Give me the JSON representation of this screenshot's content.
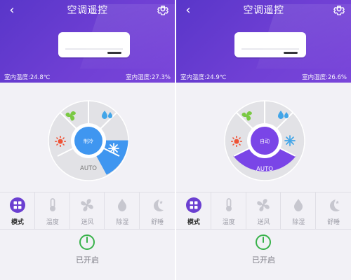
{
  "screens": [
    {
      "header": {
        "back_icon": "chevron-left-icon",
        "title": "空调遥控",
        "settings_icon": "gear-icon",
        "indoor_temp": "室内温度:24.8℃",
        "indoor_humidity": "室内湿度:27.3%"
      },
      "dial": {
        "center_label": "制冷",
        "bottom_label": "AUTO",
        "selected": "snowflake",
        "icons": [
          "fan-icon",
          "droplets-icon",
          "sun-icon",
          "snowflake-icon"
        ]
      },
      "modes": [
        {
          "label": "模式",
          "icon": "grid-icon",
          "active": true
        },
        {
          "label": "温度",
          "icon": "thermometer-icon",
          "active": false
        },
        {
          "label": "送风",
          "icon": "fan-icon",
          "active": false
        },
        {
          "label": "除湿",
          "icon": "droplet-icon",
          "active": false
        },
        {
          "label": "舒睡",
          "icon": "moon-icon",
          "active": false
        }
      ],
      "power": {
        "label": "已开启",
        "icon": "power-icon"
      }
    },
    {
      "header": {
        "back_icon": "chevron-left-icon",
        "title": "空调遥控",
        "settings_icon": "gear-icon",
        "indoor_temp": "室内温度:24.9℃",
        "indoor_humidity": "室内湿度:26.6%"
      },
      "dial": {
        "center_label": "自动",
        "bottom_label": "AUTO",
        "selected": "auto",
        "icons": [
          "fan-icon",
          "droplets-icon",
          "sun-icon",
          "snowflake-icon"
        ]
      },
      "modes": [
        {
          "label": "模式",
          "icon": "grid-icon",
          "active": true
        },
        {
          "label": "温度",
          "icon": "thermometer-icon",
          "active": false
        },
        {
          "label": "送风",
          "icon": "fan-icon",
          "active": false
        },
        {
          "label": "除湿",
          "icon": "droplet-icon",
          "active": false
        },
        {
          "label": "舒睡",
          "icon": "moon-icon",
          "active": false
        }
      ],
      "power": {
        "label": "已开启",
        "icon": "power-icon"
      }
    }
  ],
  "colors": {
    "purple": "#6b3fd1",
    "cool_blue": "#3f96f0",
    "auto_purple": "#7a45e7",
    "green": "#38b24a",
    "sun_red": "#ef5235"
  }
}
